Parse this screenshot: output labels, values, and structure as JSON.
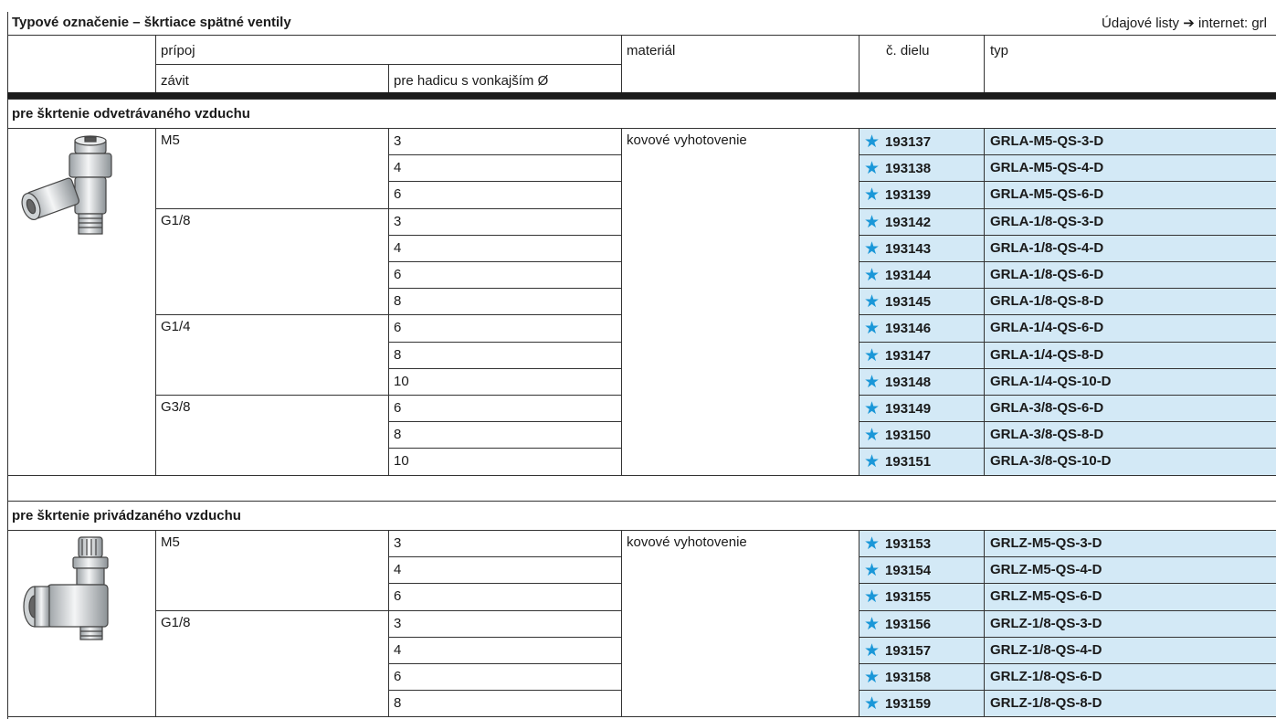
{
  "header": {
    "title": "Typové označenie – škrtiace spätné ventily",
    "reference": "Údajové listy ➔ internet: grl"
  },
  "columns": {
    "pripoj": "prípoj",
    "zavit": "závit",
    "hadica": "pre hadicu s vonkajším Ø",
    "material": "materiál",
    "cislo": "č. dielu",
    "typ": "typ"
  },
  "sections": [
    {
      "title": "pre škrtenie odvetrávaného vzduchu",
      "material": "kovové vyhotovenie",
      "image_icon": "throttle-valve-exhaust-icon",
      "groups": [
        {
          "thread": "M5",
          "rows": [
            {
              "hose": "3",
              "part": "193137",
              "type": "GRLA-M5-QS-3-D"
            },
            {
              "hose": "4",
              "part": "193138",
              "type": "GRLA-M5-QS-4-D"
            },
            {
              "hose": "6",
              "part": "193139",
              "type": "GRLA-M5-QS-6-D"
            }
          ]
        },
        {
          "thread": "G1/8",
          "rows": [
            {
              "hose": "3",
              "part": "193142",
              "type": "GRLA-1/8-QS-3-D"
            },
            {
              "hose": "4",
              "part": "193143",
              "type": "GRLA-1/8-QS-4-D"
            },
            {
              "hose": "6",
              "part": "193144",
              "type": "GRLA-1/8-QS-6-D"
            },
            {
              "hose": "8",
              "part": "193145",
              "type": "GRLA-1/8-QS-8-D"
            }
          ]
        },
        {
          "thread": "G1/4",
          "rows": [
            {
              "hose": "6",
              "part": "193146",
              "type": "GRLA-1/4-QS-6-D"
            },
            {
              "hose": "8",
              "part": "193147",
              "type": "GRLA-1/4-QS-8-D"
            },
            {
              "hose": "10",
              "part": "193148",
              "type": "GRLA-1/4-QS-10-D"
            }
          ]
        },
        {
          "thread": "G3/8",
          "rows": [
            {
              "hose": "6",
              "part": "193149",
              "type": "GRLA-3/8-QS-6-D"
            },
            {
              "hose": "8",
              "part": "193150",
              "type": "GRLA-3/8-QS-8-D"
            },
            {
              "hose": "10",
              "part": "193151",
              "type": "GRLA-3/8-QS-10-D"
            }
          ]
        }
      ]
    },
    {
      "title": "pre škrtenie privádzaného vzduchu",
      "material": "kovové vyhotovenie",
      "image_icon": "throttle-valve-supply-icon",
      "groups": [
        {
          "thread": "M5",
          "rows": [
            {
              "hose": "3",
              "part": "193153",
              "type": "GRLZ-M5-QS-3-D"
            },
            {
              "hose": "4",
              "part": "193154",
              "type": "GRLZ-M5-QS-4-D"
            },
            {
              "hose": "6",
              "part": "193155",
              "type": "GRLZ-M5-QS-6-D"
            }
          ]
        },
        {
          "thread": "G1/8",
          "rows": [
            {
              "hose": "3",
              "part": "193156",
              "type": "GRLZ-1/8-QS-3-D"
            },
            {
              "hose": "4",
              "part": "193157",
              "type": "GRLZ-1/8-QS-4-D"
            },
            {
              "hose": "6",
              "part": "193158",
              "type": "GRLZ-1/8-QS-6-D"
            },
            {
              "hose": "8",
              "part": "193159",
              "type": "GRLZ-1/8-QS-8-D"
            }
          ]
        }
      ]
    }
  ],
  "colors": {
    "part_highlight": "#d3e9f6",
    "star": "#1a97d8",
    "rule": "#333333"
  },
  "icons": {
    "preferred_marker": "star-icon"
  }
}
